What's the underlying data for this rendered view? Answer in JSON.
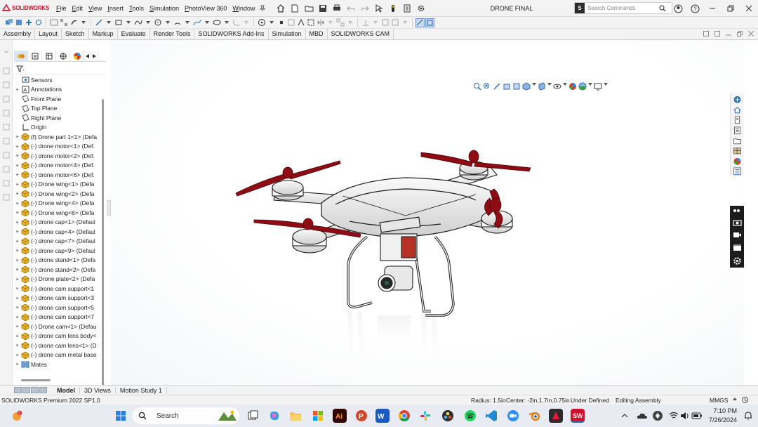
{
  "app": {
    "brand": "SOLIDWORKS",
    "document_title": "DRONE FINAL"
  },
  "menu": [
    "File",
    "Edit",
    "View",
    "Insert",
    "Tools",
    "Simulation",
    "PhotoView 360",
    "Window"
  ],
  "search": {
    "placeholder": "Search Commands"
  },
  "tabs": [
    "Assembly",
    "Layout",
    "Sketch",
    "Markup",
    "Evaluate",
    "Render Tools",
    "SOLIDWORKS Add-Ins",
    "Simulation",
    "MBD",
    "SOLIDWORKS CAM"
  ],
  "tree": [
    {
      "label": "Sensors",
      "arrow": "",
      "icon": "sensor-icon"
    },
    {
      "label": "Annotations",
      "arrow": "▸",
      "icon": "annotation-icon"
    },
    {
      "label": "Front Plane",
      "arrow": "",
      "icon": "plane-icon"
    },
    {
      "label": "Top Plane",
      "arrow": "",
      "icon": "plane-icon"
    },
    {
      "label": "Right Plane",
      "arrow": "",
      "icon": "plane-icon"
    },
    {
      "label": "Origin",
      "arrow": "",
      "icon": "origin-icon"
    },
    {
      "label": "(f) Drone part 1<1> (Defa",
      "arrow": "▸",
      "icon": "part-icon"
    },
    {
      "label": "(-) drone motor<1> (Def.",
      "arrow": "▸",
      "icon": "part-icon"
    },
    {
      "label": "(-) drone motor<2> (Def.",
      "arrow": "▸",
      "icon": "part-icon"
    },
    {
      "label": "(-) drone motor<4> (Def.",
      "arrow": "▸",
      "icon": "part-icon"
    },
    {
      "label": "(-) drone motor<6> (Def.",
      "arrow": "▸",
      "icon": "part-icon"
    },
    {
      "label": "(-) Drone wing<1> (Defa",
      "arrow": "▸",
      "icon": "part-icon"
    },
    {
      "label": "(-) Drone wing<2> (Defa",
      "arrow": "▸",
      "icon": "part-icon"
    },
    {
      "label": "(-) Drone wing<4> (Defa",
      "arrow": "▸",
      "icon": "part-icon"
    },
    {
      "label": "(-) Drone wing<6> (Defa",
      "arrow": "▸",
      "icon": "part-icon"
    },
    {
      "label": "(-) drone cap<1> (Defaul",
      "arrow": "▸",
      "icon": "part-icon"
    },
    {
      "label": "(-) drone cap<4> (Defaul",
      "arrow": "▸",
      "icon": "part-icon"
    },
    {
      "label": "(-) drone cap<7> (Defaul",
      "arrow": "▸",
      "icon": "part-icon"
    },
    {
      "label": "(-) drone cap<9> (Defaul",
      "arrow": "▸",
      "icon": "part-icon"
    },
    {
      "label": "(-) drone stand<1> (Defa",
      "arrow": "▸",
      "icon": "part-icon"
    },
    {
      "label": "(-) drone stand<2> (Defa",
      "arrow": "▸",
      "icon": "part-icon"
    },
    {
      "label": "(-) Drone plate<2> (Defa",
      "arrow": "▸",
      "icon": "part-icon"
    },
    {
      "label": "(-) drone cam support<1",
      "arrow": "▸",
      "icon": "part-icon"
    },
    {
      "label": "(-) drone cam support<3",
      "arrow": "▸",
      "icon": "part-icon"
    },
    {
      "label": "(-) drone cam support<5",
      "arrow": "▸",
      "icon": "part-icon"
    },
    {
      "label": "(-) drone cam support<7",
      "arrow": "▸",
      "icon": "part-icon"
    },
    {
      "label": "(-) Drone cam<1> (Defau",
      "arrow": "▸",
      "icon": "part-icon"
    },
    {
      "label": "(-) drone cam lens body<",
      "arrow": "▸",
      "icon": "part-icon"
    },
    {
      "label": "(-) drone cam lens<1> (D",
      "arrow": "▸",
      "icon": "part-icon"
    },
    {
      "label": "(-) drone cam metal base",
      "arrow": "▸",
      "icon": "part-icon"
    },
    {
      "label": "Mates",
      "arrow": "▸",
      "icon": "mates-icon"
    }
  ],
  "bottom_tabs": [
    "Model",
    "3D Views",
    "Motion Study 1"
  ],
  "status": {
    "product": "SOLIDWORKS Premium 2022 SP1.0",
    "radius": "Radius: 1.5in",
    "center": "Center: -2in,1.7in,0.75in",
    "definition": "Under Defined",
    "mode": "Editing Assembly",
    "units": "MMGS"
  },
  "taskbar": {
    "search_label": "Search",
    "time": "7:10 PM",
    "date": "7/26/2024",
    "notification_badge": "1"
  },
  "colors": {
    "brand_red": "#d0112b",
    "propeller": "#8e0c14",
    "accent_blue": "#2c6fb6"
  }
}
